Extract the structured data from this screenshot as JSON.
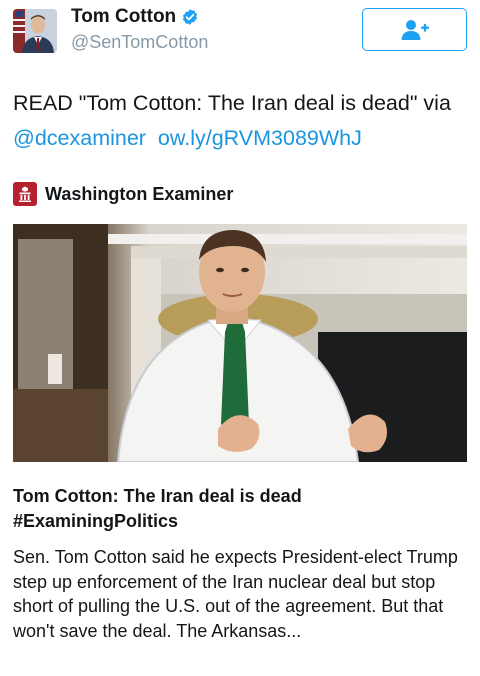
{
  "header": {
    "display_name": "Tom Cotton",
    "handle": "@SenTomCotton",
    "verified": true,
    "follow_icon": "follow-person-plus-icon"
  },
  "tweet": {
    "text_prefix": "READ \"Tom Cotton: The Iran deal is dead\" via ",
    "mention": "@dcexaminer",
    "link": "ow.ly/gRVM3089WhJ"
  },
  "card": {
    "source_name": "Washington Examiner",
    "source_icon": "washington-examiner-logo-icon",
    "title_line1": "Tom Cotton: The Iran deal is dead",
    "title_line2": "#ExaminingPolitics",
    "description": "Sen. Tom Cotton said he expects President-elect Trump step up enforcement of the Iran nuclear deal but stop short of pulling the U.S. out of the agreement. But that won't save the deal. The Arkansas..."
  },
  "colors": {
    "accent": "#1da1f2",
    "link": "#1b95e0",
    "muted": "#8899a6",
    "source_brand": "#b5222d"
  }
}
